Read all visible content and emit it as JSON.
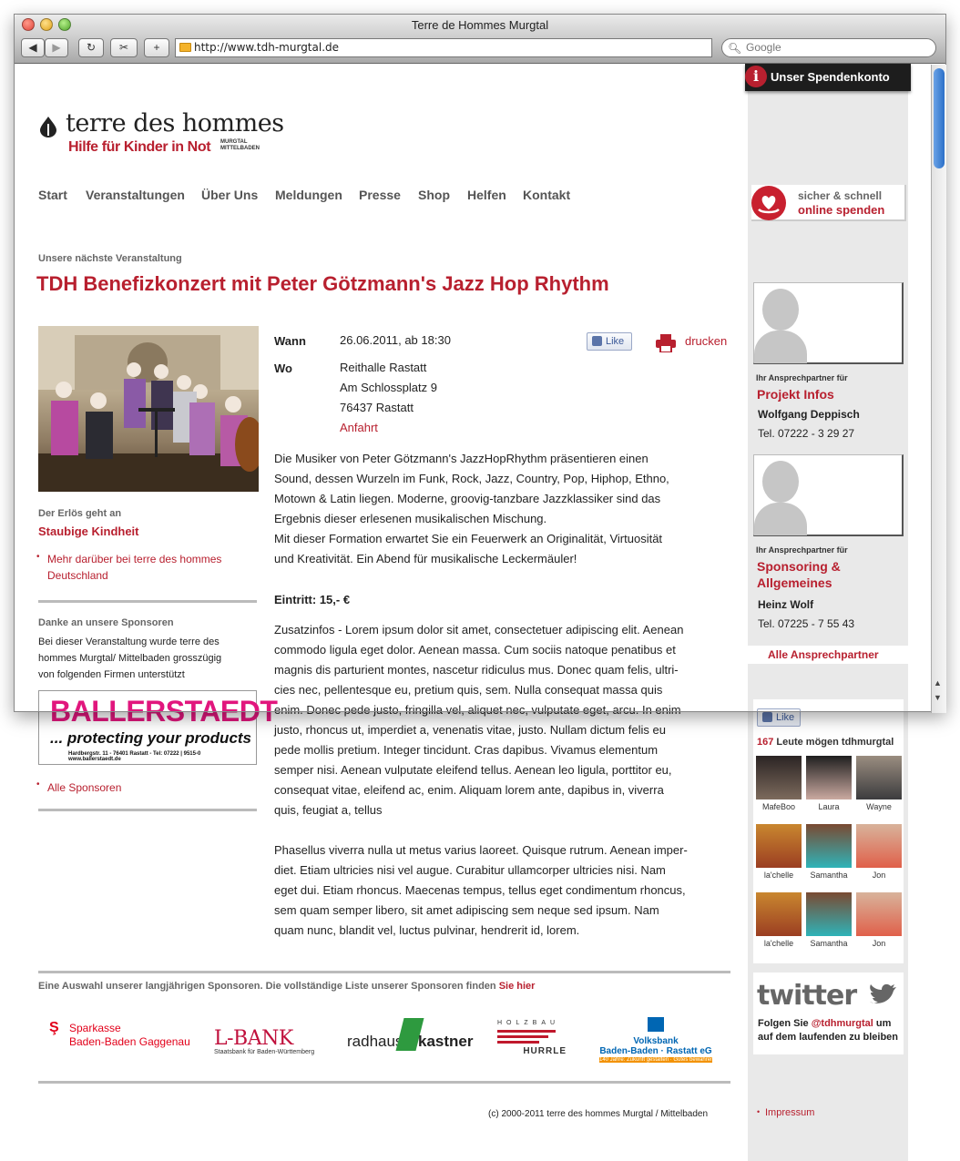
{
  "window": {
    "title": "Terre de Hommes Murgtal",
    "url": "http://www.tdh-murgtal.de",
    "search_placeholder": "Google"
  },
  "logo": {
    "name": "terre des hommes",
    "tagline": "Hilfe für Kinder in Not",
    "region_line1": "MURGTAL",
    "region_line2": "MITTELBADEN"
  },
  "nav": {
    "items": [
      "Start",
      "Veranstaltungen",
      "Über Uns",
      "Meldungen",
      "Presse",
      "Shop",
      "Helfen",
      "Kontakt"
    ],
    "active": "Start"
  },
  "event": {
    "kicker": "Unsere nächste Veranstaltung",
    "title": "TDH Benefizkonzert mit Peter Götzmann's Jazz Hop Rhythm",
    "when_label": "Wann",
    "when_value": "26.06.2011, ab 18:30",
    "where_label": "Wo",
    "where_lines": [
      "Reithalle Rastatt",
      "Am Schlossplatz 9",
      "76437 Rastatt"
    ],
    "directions_link": "Anfahrt",
    "like_label": "Like",
    "print_label": "drucken",
    "description": [
      "Die Musiker von Peter Götzmann's JazzHopRhythm präsentieren einen",
      "Sound, dessen Wurzeln im Funk, Rock, Jazz, Country, Pop, Hiphop, Ethno,",
      "Motown & Latin liegen. Moderne, groovig-tanzbare Jazzklassiker sind das",
      "Ergebnis dieser erlesenen musikalischen Mischung.",
      "Mit dieser Formation erwartet Sie ein Feuerwerk an Originalität, Virtuosität",
      "und Kreativität. Ein Abend für musikalische Leckermäuler!"
    ],
    "admission": "Eintritt: 15,- €",
    "extra_info": [
      "Zusatzinfos - Lorem ipsum dolor sit amet, consectetuer adipiscing elit. Aenean",
      "commodo ligula eget dolor. Aenean massa. Cum sociis natoque penatibus et",
      "magnis dis parturient montes, nascetur ridiculus mus. Donec quam felis, ultri-",
      "cies nec, pellentesque eu, pretium quis, sem. Nulla consequat massa quis",
      "enim. Donec pede justo, fringilla vel, aliquet nec, vulputate eget, arcu. In enim",
      "justo, rhoncus ut, imperdiet a, venenatis vitae, justo. Nullam dictum felis eu",
      "pede mollis pretium. Integer tincidunt. Cras dapibus. Vivamus elementum",
      "semper nisi. Aenean vulputate eleifend tellus. Aenean leo ligula, porttitor eu,",
      "consequat vitae, eleifend ac, enim. Aliquam lorem ante, dapibus in, viverra",
      "quis, feugiat a, tellus"
    ],
    "extra_info_2": [
      "Phasellus viverra nulla ut metus varius laoreet. Quisque rutrum. Aenean imper-",
      "diet. Etiam ultricies nisi vel augue. Curabitur ullamcorper ultricies nisi. Nam",
      "eget dui. Etiam rhoncus. Maecenas tempus, tellus eget condimentum rhoncus,",
      "sem quam semper libero, sit amet adipiscing sem neque sed ipsum. Nam",
      "quam nunc, blandit vel, luctus pulvinar, hendrerit id, lorem."
    ]
  },
  "left": {
    "proceeds_label": "Der Erlös geht an",
    "proceeds_target": "Staubige Kindheit",
    "more_link_l1": "Mehr darüber bei terre des hommes",
    "more_link_l2": "Deutschland",
    "sponsors_heading": "Danke an unsere Sponsoren",
    "sponsors_text": [
      "Bei dieser Veranstaltung wurde terre des",
      "hommes Murgtal/ Mittelbaden grosszügig",
      "von folgenden Firmen unterstützt"
    ],
    "ad_brand": "BALLERSTAEDT",
    "ad_claim": "... protecting your products",
    "ad_address": "Hardbergstr. 11 - 76401 Rastatt - Tel: 07222 | 9515-0",
    "ad_web": "www.ballerstaedt.de",
    "all_sponsors": "Alle Sponsoren"
  },
  "footer": {
    "sponsors_text": "Eine Auswahl unserer langjährigen Sponsoren. Die vollständige Liste unserer Sponsoren finden ",
    "sponsors_link": "Sie hier",
    "logos": {
      "sparkasse_l1": "Sparkasse",
      "sparkasse_l2": "Baden-Baden Gaggenau",
      "lbank": "L-BANK",
      "lbank_sub": "Staatsbank für Baden-Württemberg",
      "radhaus": "radhaus",
      "kastner": "kastner",
      "holzbau": "HOLZBAU",
      "hurrle": "HURRLE",
      "volksbank": "Volksbank",
      "volksbank_sub": "Baden-Baden · Rastatt eG",
      "volksbank_tag": "140 Jahre: Zukunft gestalten · Gutes bewahren"
    },
    "copyright": "(c) 2000-2011 terre des hommes Murgtal / Mittelbaden",
    "impressum": "Impressum"
  },
  "sidebar": {
    "spendenkonto": "Unser Spendenkonto",
    "donate_l1": "sicher & schnell",
    "donate_l2": "online spenden",
    "contacts": [
      {
        "for": "Ihr Ansprechpartner für",
        "topic_l1": "Projekt Infos",
        "topic_l2": "",
        "name": "Wolfgang Deppisch",
        "tel": "Tel. 07222 - 3 29 27"
      },
      {
        "for": "Ihr Ansprechpartner für",
        "topic_l1": "Sponsoring &",
        "topic_l2": "Allgemeines",
        "name": "Heinz Wolf",
        "tel": "Tel. 07225 - 7 55 43"
      }
    ],
    "all_contacts": "Alle Ansprechpartner",
    "facebook": {
      "like_label": "Like",
      "count": "167",
      "count_text": " Leute mögen tdhmurgtal",
      "fans": [
        "MafeBoo",
        "Laura",
        "Wayne",
        "la'chelle",
        "Samantha",
        "Jon",
        "la'chelle",
        "Samantha",
        "Jon"
      ]
    },
    "twitter": {
      "logo": "twitter",
      "text_pre": "Folgen Sie ",
      "handle": "@tdhmurgtal",
      "text_post": " um auf dem laufenden zu bleiben"
    }
  },
  "colors": {
    "brand_red": "#b8202f",
    "sidebar_grey": "#e9e9e9",
    "ad_pink": "#e1167d"
  }
}
